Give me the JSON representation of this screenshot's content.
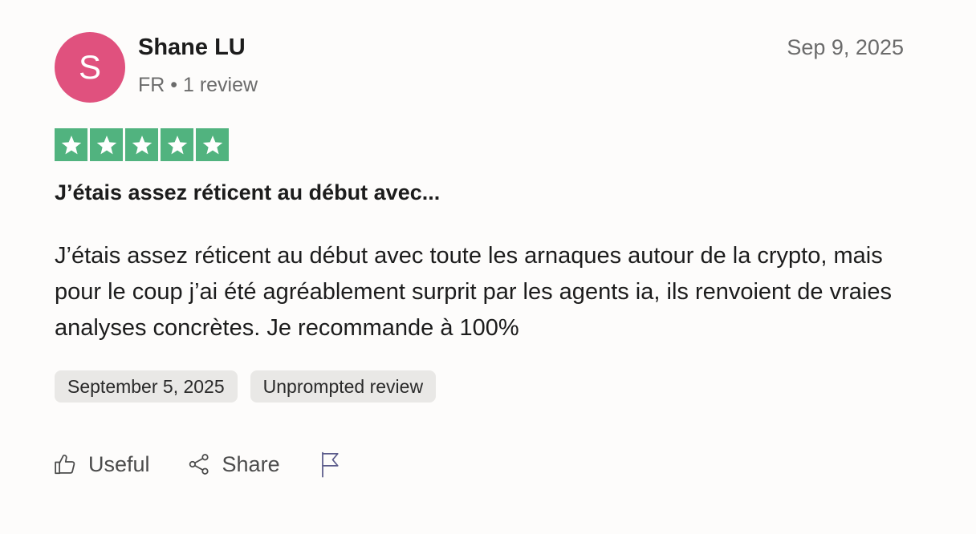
{
  "reviewer": {
    "initial": "S",
    "name": "Shane LU",
    "meta": "FR • 1 review",
    "avatar_color": "#e0517e"
  },
  "review": {
    "posted_date": "Sep 9, 2025",
    "rating": 5,
    "star_color": "#51b37f",
    "title": "J’étais assez réticent au début avec...",
    "body": "J’étais assez réticent au début avec toute les arnaques autour de la crypto, mais pour le coup j’ai été agréablement surprit par les agents ia, ils renvoient de vraies analyses concrètes. Je recommande à 100%"
  },
  "tags": {
    "experience_date": "September 5, 2025",
    "review_type": "Unprompted review"
  },
  "actions": {
    "useful_label": "Useful",
    "useful_icon": "thumbs-up-icon",
    "share_label": "Share",
    "share_icon": "share-icon",
    "report_icon": "flag-icon"
  }
}
